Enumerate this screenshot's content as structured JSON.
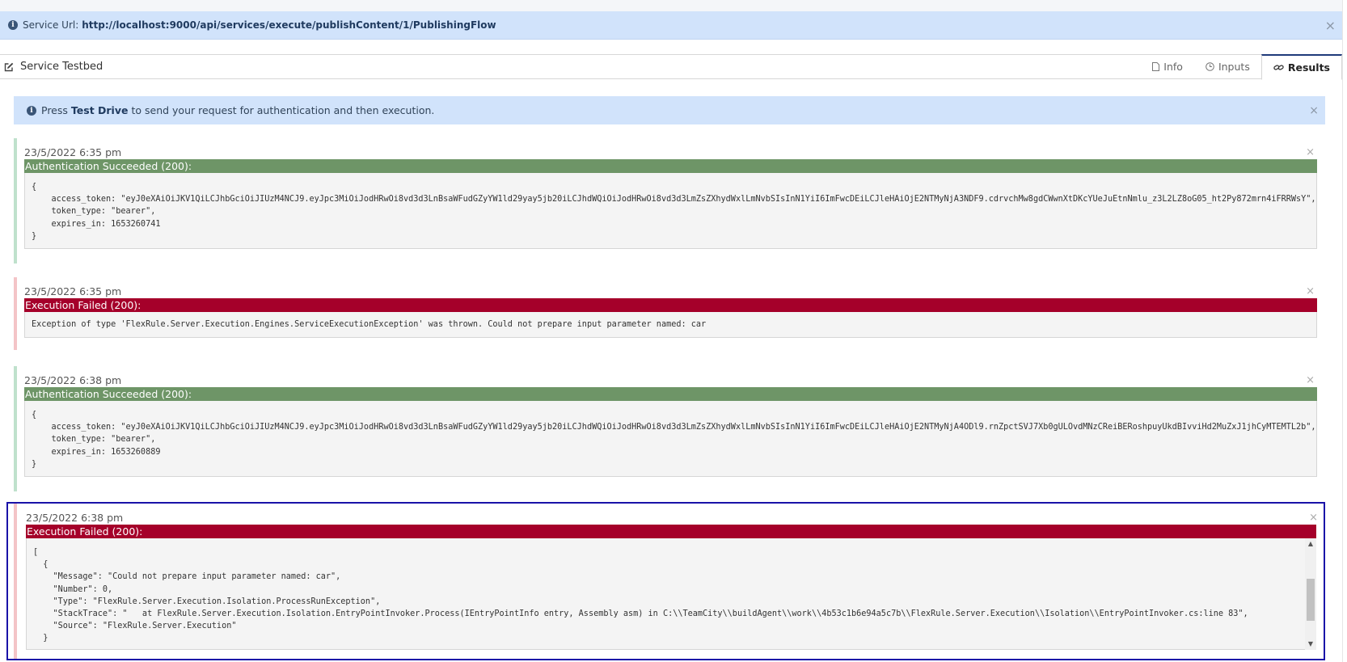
{
  "service_url": {
    "label": "Service Url:",
    "value": "http://localhost:9000/api/services/execute/publishContent/1/PublishingFlow",
    "close": "×"
  },
  "header": {
    "title": "Service Testbed",
    "tabs": [
      {
        "label": "Info",
        "icon": "file-icon"
      },
      {
        "label": "Inputs",
        "icon": "clock-icon"
      },
      {
        "label": "Results",
        "icon": "link-icon",
        "active": true
      }
    ]
  },
  "hint": {
    "prefix": "Press",
    "action": "Test Drive",
    "suffix": "to send your request for authentication and then execution.",
    "close": "×"
  },
  "entries": [
    {
      "timestamp": "23/5/2022 6:35 pm",
      "status": "Authentication Succeeded (200):",
      "kind": "success",
      "body": "{\n    access_token: \"eyJ0eXAiOiJKV1QiLCJhbGciOiJIUzM4NCJ9.eyJpc3MiOiJodHRwOi8vd3d3LnBsaWFudGZyYW1ld29yay5jb20iLCJhdWQiOiJodHRwOi8vd3d3LmZsZXhydWxlLmNvbSIsInN1YiI6ImFwcDEiLCJleHAiOjE2NTMyNjA3NDF9.cdrvchMw8gdCWwnXtDKcYUeJuEtnNmlu_z3L2LZ8oG05_ht2Py872mrn4iFRRWsY\",\n    token_type: \"bearer\",\n    expires_in: 1653260741\n}"
    },
    {
      "timestamp": "23/5/2022 6:35 pm",
      "status": "Execution Failed (200):",
      "kind": "fail",
      "body": "Exception of type 'FlexRule.Server.Execution.Engines.ServiceExecutionException' was thrown. Could not prepare input parameter named: car"
    },
    {
      "timestamp": "23/5/2022 6:38 pm",
      "status": "Authentication Succeeded (200):",
      "kind": "success",
      "body": "{\n    access_token: \"eyJ0eXAiOiJKV1QiLCJhbGciOiJIUzM4NCJ9.eyJpc3MiOiJodHRwOi8vd3d3LnBsaWFudGZyYW1ld29yay5jb20iLCJhdWQiOiJodHRwOi8vd3d3LmZsZXhydWxlLmNvbSIsInN1YiI6ImFwcDEiLCJleHAiOjE2NTMyNjA4ODl9.rnZpctSVJ7Xb0gULOvdMNzCReiBERoshpuyUkdBIvviHd2MuZxJ1jhCyMTEMTL2b\",\n    token_type: \"bearer\",\n    expires_in: 1653260889\n}"
    },
    {
      "timestamp": "23/5/2022 6:38 pm",
      "status": "Execution Failed (200):",
      "kind": "fail",
      "body": "[\n  {\n    \"Message\": \"Could not prepare input parameter named: car\",\n    \"Number\": 0,\n    \"Type\": \"FlexRule.Server.Execution.Isolation.ProcessRunException\",\n    \"StackTrace\": \"   at FlexRule.Server.Execution.Isolation.EntryPointInvoker.Process(IEntryPointInfo entry, Assembly asm) in C:\\\\TeamCity\\\\buildAgent\\\\work\\\\4b53c1b6e94a5c7b\\\\FlexRule.Server.Execution\\\\Isolation\\\\EntryPointInvoker.cs:line 83\",\n    \"Source\": \"FlexRule.Server.Execution\"\n  }"
    }
  ],
  "entry_close": "×",
  "colors": {
    "banner_bg": "#d1e3fb",
    "success": "#6e9567",
    "fail": "#a5002a",
    "selected_border": "#1a12a8"
  }
}
